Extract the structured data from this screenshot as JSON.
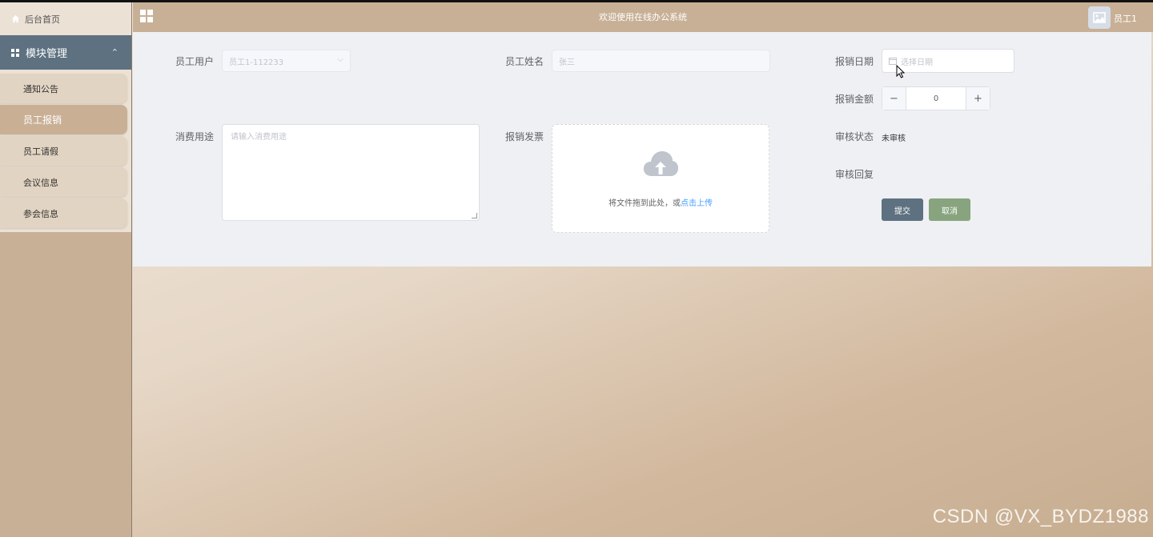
{
  "sidebar": {
    "home_label": "后台首页",
    "module_label": "模块管理",
    "items": [
      {
        "label": "通知公告"
      },
      {
        "label": "员工报销"
      },
      {
        "label": "员工请假"
      },
      {
        "label": "会议信息"
      },
      {
        "label": "参会信息"
      }
    ]
  },
  "header": {
    "title": "欢迎使用在线办公系统",
    "user": "员工1"
  },
  "form": {
    "employee_user_label": "员工用户",
    "employee_user_value": "员工1-112233",
    "employee_name_label": "员工姓名",
    "employee_name_value": "张三",
    "date_label": "报销日期",
    "date_placeholder": "选择日期",
    "amount_label": "报销金额",
    "amount_value": "0",
    "purpose_label": "消费用途",
    "purpose_placeholder": "请输入消费用途",
    "invoice_label": "报销发票",
    "upload_text": "将文件拖到此处，或",
    "upload_link": "点击上传",
    "status_label": "审核状态",
    "status_value": "未审核",
    "reply_label": "审核回复",
    "submit_label": "提交",
    "cancel_label": "取消"
  },
  "watermark": "CSDN @VX_BYDZ1988"
}
